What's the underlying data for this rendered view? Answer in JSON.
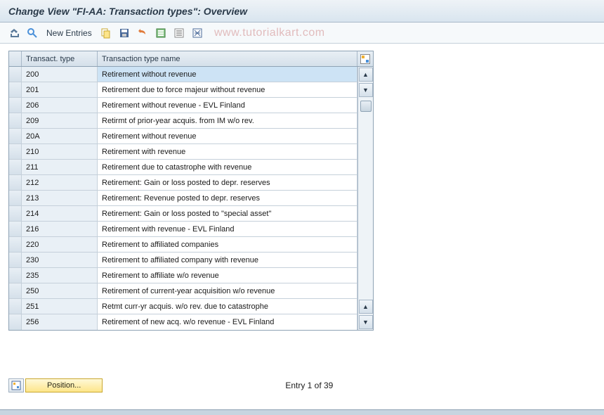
{
  "title": "Change View \"FI-AA: Transaction types\": Overview",
  "watermark": "www.tutorialkart.com",
  "toolbar": {
    "new_entries": "New Entries"
  },
  "table": {
    "headers": {
      "code": "Transact. type",
      "name": "Transaction type name"
    },
    "rows": [
      {
        "code": "200",
        "name": "Retirement without revenue",
        "selected": true
      },
      {
        "code": "201",
        "name": "Retirement due to force majeur without revenue"
      },
      {
        "code": "206",
        "name": "Retirement without revenue - EVL Finland"
      },
      {
        "code": "209",
        "name": "Retirmt of prior-year acquis. from IM w/o rev."
      },
      {
        "code": "20A",
        "name": "Retirement without revenue"
      },
      {
        "code": "210",
        "name": "Retirement with revenue"
      },
      {
        "code": "211",
        "name": "Retirement due to catastrophe with revenue"
      },
      {
        "code": "212",
        "name": "Retirement: Gain or loss posted to depr. reserves"
      },
      {
        "code": "213",
        "name": "Retirement: Revenue posted to depr. reserves"
      },
      {
        "code": "214",
        "name": "Retirement: Gain or loss posted to \"special asset\""
      },
      {
        "code": "216",
        "name": "Retirement with revenue - EVL Finland"
      },
      {
        "code": "220",
        "name": "Retirement to affiliated companies"
      },
      {
        "code": "230",
        "name": "Retirement to affiliated company with revenue"
      },
      {
        "code": "235",
        "name": "Retirement to affiliate w/o revenue"
      },
      {
        "code": "250",
        "name": "Retirement of current-year acquisition w/o revenue"
      },
      {
        "code": "251",
        "name": "Retmt curr-yr acquis. w/o rev. due to catastrophe"
      },
      {
        "code": "256",
        "name": "Retirement of new acq. w/o revenue - EVL Finland"
      }
    ]
  },
  "footer": {
    "position_label": "Position...",
    "status": "Entry 1 of 39"
  }
}
